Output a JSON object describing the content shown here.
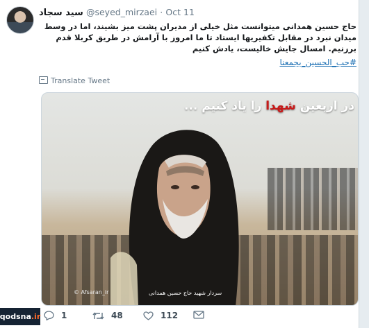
{
  "tweet": {
    "display_name": "سید سجاد",
    "handle": "@seyed_mirzaei",
    "separator": "·",
    "date": "Oct 11",
    "text": "حاج حسین همدانی میتوانست مثل خیلی از مدیران پشت میز بشیند، اما در وسط میدان نبرد در مقابل تکفیریها ایستاد تا ما امروز با آرامش در طریق کربلا قدم برزنیم. امسال جایش خالیست، یادش کنیم",
    "hashtag": "#حب_الحسين_يجمعنا",
    "translate_label": "Translate Tweet"
  },
  "media": {
    "banner_prefix": "در اربعین",
    "banner_highlight": "شهدا",
    "banner_suffix": "را یاد کنیم ...",
    "caption": "سردار شهید حاج حسین همدانی",
    "image_watermark": "© Afsaran_ir",
    "highlight_color": "#c81a1a"
  },
  "actions": {
    "reply_count": "1",
    "retweet_count": "48",
    "like_count": "112"
  },
  "watermark": {
    "prefix": "qodsna",
    "suffix": ".ir"
  },
  "colors": {
    "link": "#1b6fb3",
    "muted": "#657786",
    "watermark_bg": "#152333"
  }
}
